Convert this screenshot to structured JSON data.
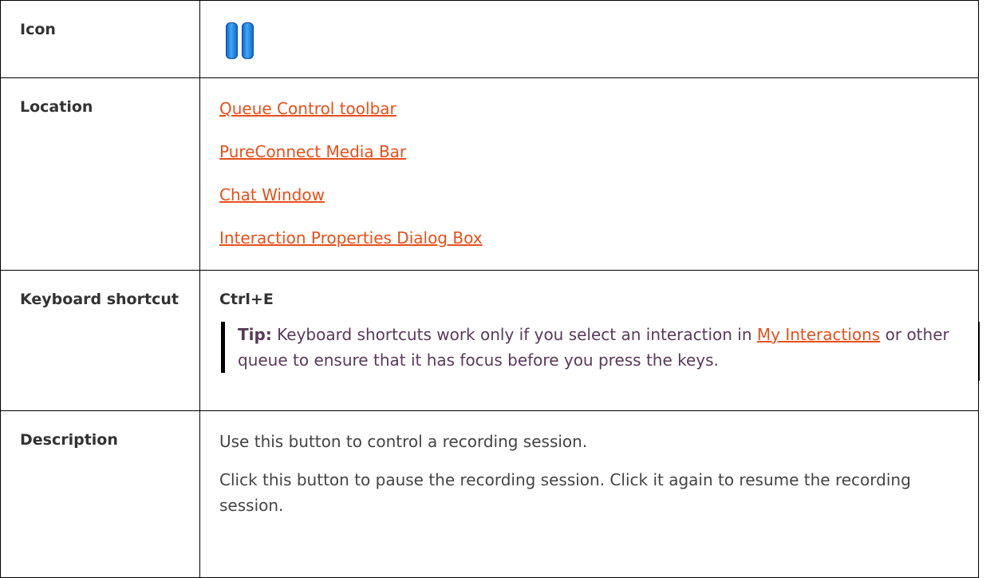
{
  "rows": {
    "icon": {
      "label": "Icon",
      "icon_name": "pause-icon",
      "icon_color": "#1f7fe0"
    },
    "location": {
      "label": "Location",
      "links": [
        "Queue Control toolbar",
        "PureConnect Media Bar",
        "Chat Window",
        "Interaction Properties Dialog Box"
      ]
    },
    "keyboard": {
      "label": "Keyboard shortcut",
      "shortcut": "Ctrl+E",
      "tip_label": "Tip:",
      "tip_text_before": " Keyboard shortcuts work only if you select an interaction in ",
      "tip_link": "My Interactions",
      "tip_text_after": " or other queue to ensure that it has focus before you press the keys."
    },
    "description": {
      "label": "Description",
      "paragraphs": [
        "Use this button to control a recording session.",
        "Click this button to pause the recording session. Click it again to resume the recording session."
      ]
    }
  },
  "colors": {
    "link": "#e8501a",
    "border": "#000000",
    "tip_text": "#5a3a5a"
  }
}
